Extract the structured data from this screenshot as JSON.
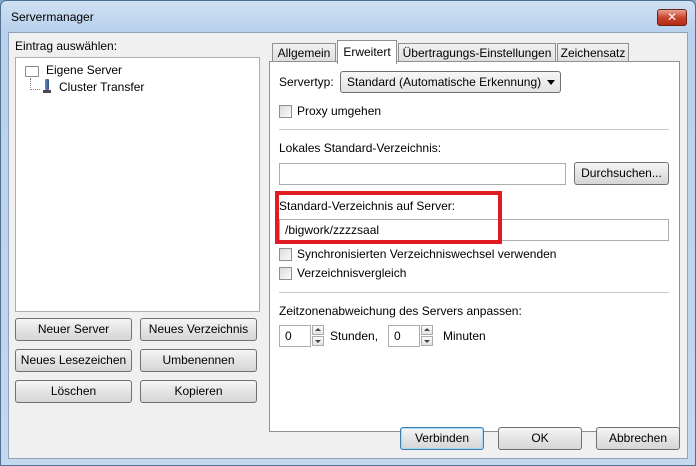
{
  "window": {
    "title": "Servermanager",
    "close_glyph": "✕"
  },
  "left": {
    "tree_label": "Eintrag auswählen:",
    "tree": [
      {
        "label": "Eigene Server",
        "icon": "folder-icon"
      },
      {
        "label": "Cluster Transfer",
        "icon": "server-icon"
      }
    ],
    "buttons": {
      "new_server": "Neuer Server",
      "new_folder": "Neues Verzeichnis",
      "new_bookmark": "Neues Lesezeichen",
      "rename": "Umbenennen",
      "delete": "Löschen",
      "copy": "Kopieren"
    }
  },
  "tabs": [
    {
      "label": "Allgemein",
      "active": false
    },
    {
      "label": "Erweitert",
      "active": true
    },
    {
      "label": "Übertragungs-Einstellungen",
      "active": false
    },
    {
      "label": "Zeichensatz",
      "active": false
    }
  ],
  "advanced": {
    "server_type_label": "Servertyp:",
    "server_type_value": "Standard (Automatische Erkennung)",
    "proxy_label": "Proxy umgehen",
    "proxy_checked": false,
    "local_dir_label": "Lokales Standard-Verzeichnis:",
    "local_dir_value": "",
    "browse_button": "Durchsuchen...",
    "remote_dir_label": "Standard-Verzeichnis auf Server:",
    "remote_dir_value": "/bigwork/zzzzsaal",
    "sync_label": "Synchronisierten Verzeichniswechsel verwenden",
    "sync_checked": false,
    "compare_label": "Verzeichnisvergleich",
    "compare_checked": false,
    "tz_label": "Zeitzonenabweichung des Servers anpassen:",
    "hours_value": "0",
    "hours_label": "Stunden,",
    "minutes_value": "0",
    "minutes_label": "Minuten"
  },
  "footer": {
    "connect": "Verbinden",
    "ok": "OK",
    "cancel": "Abbrechen"
  },
  "colors": {
    "highlight": "#e21a22",
    "default_button_border": "#3c7fb1"
  }
}
